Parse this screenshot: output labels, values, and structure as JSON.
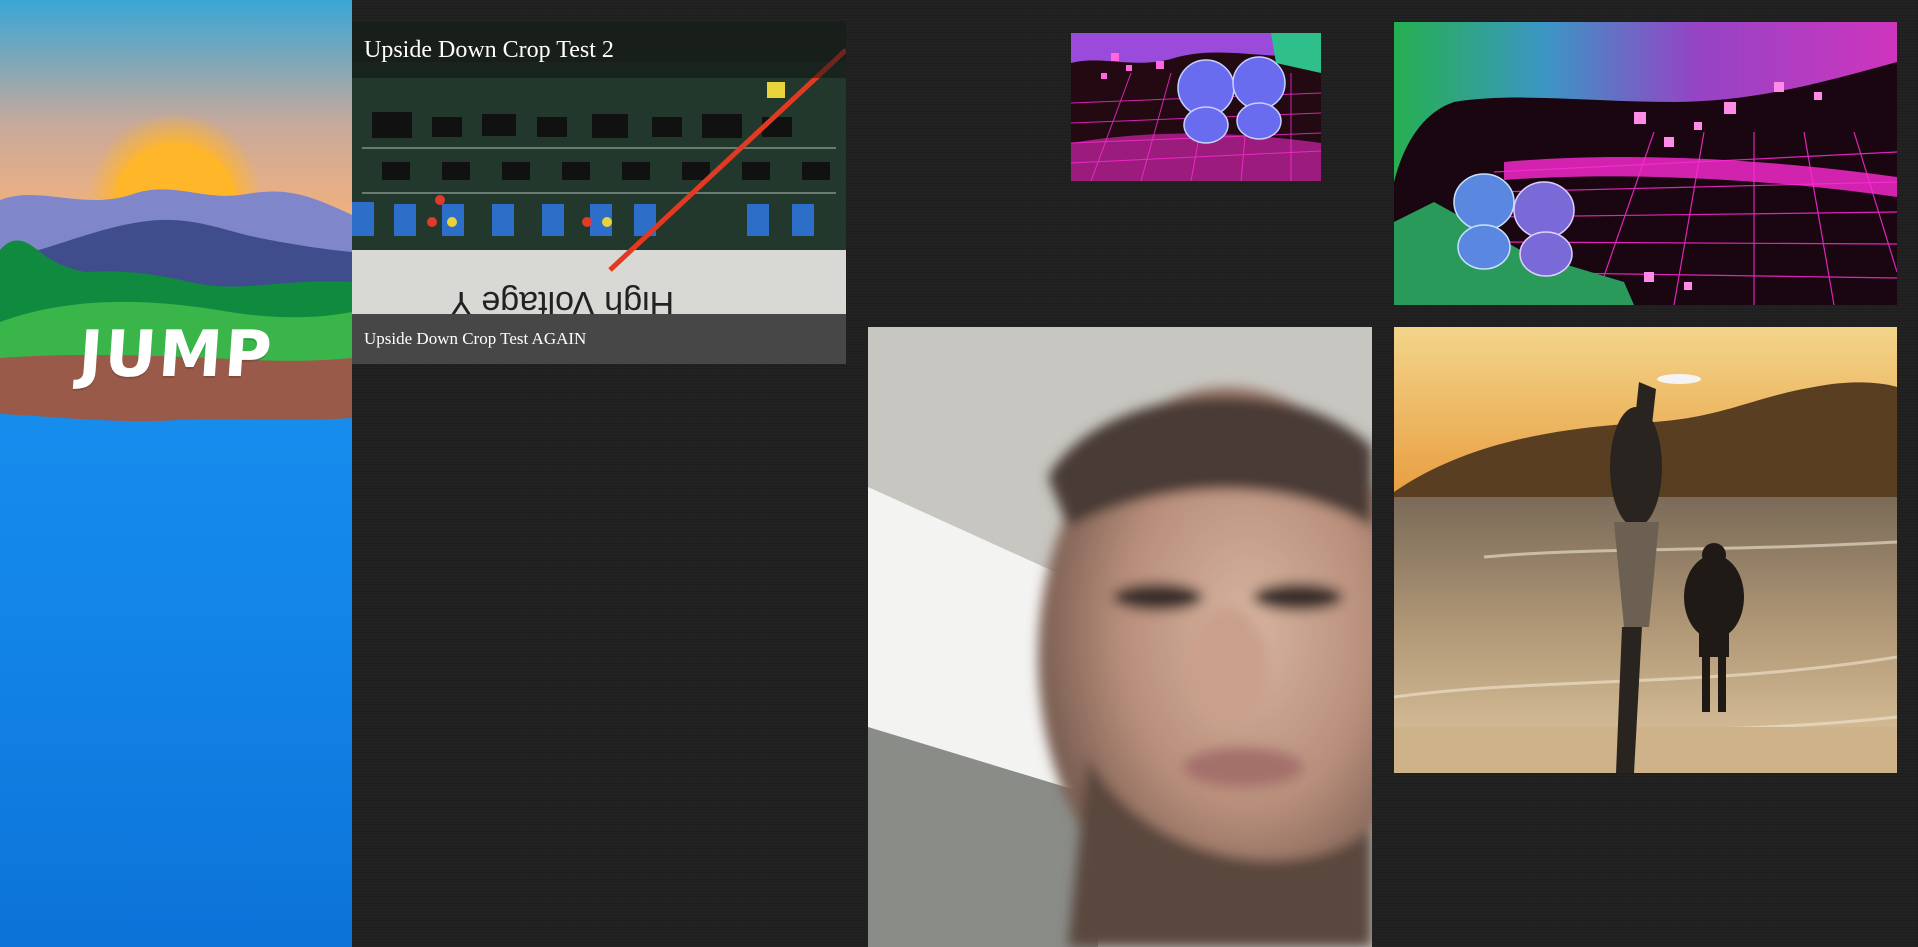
{
  "sidebar": {
    "logo_text": "JUMP",
    "colors": {
      "sky_top": "#3aa6d6",
      "sky_bottom": "#f6b07a",
      "sun": "#ffb628",
      "mountain_far": "#7f86c9",
      "mountain_mid": "#3f4d8c",
      "hills_dark": "#0f8a3e",
      "hills_light": "#39b54a",
      "ground": "#9a5a4a",
      "water": "#1494f2"
    }
  },
  "gallery": {
    "tiles": [
      {
        "id": "circuit",
        "title": "Upside Down Crop Test 2",
        "caption": "Upside Down Crop Test AGAIN",
        "image_text": "High Voltage Y"
      },
      {
        "id": "robots-small"
      },
      {
        "id": "robots-large"
      },
      {
        "id": "selfie"
      },
      {
        "id": "beach"
      }
    ]
  }
}
